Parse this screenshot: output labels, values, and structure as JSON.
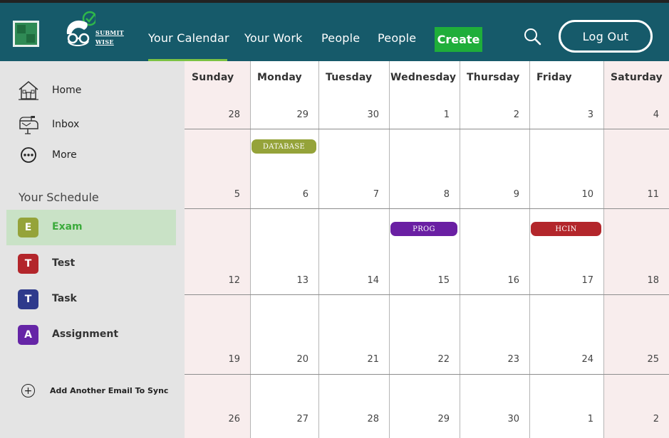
{
  "brand": {
    "name_line1": "SUBMIT",
    "name_line2": "WISE"
  },
  "nav": {
    "items": [
      {
        "label": "Your Calendar"
      },
      {
        "label": "Your Work"
      },
      {
        "label": "People"
      },
      {
        "label": "People"
      }
    ],
    "active_index": 0,
    "create_label": "Create",
    "logout_label": "Log Out"
  },
  "sidebar": {
    "links": [
      {
        "label": "Home",
        "icon": "house-icon"
      },
      {
        "label": "Inbox",
        "icon": "mailbox-icon"
      },
      {
        "label": "More",
        "icon": "more-dots-icon"
      }
    ],
    "schedule_title": "Your Schedule",
    "schedule": [
      {
        "letter": "E",
        "label": "Exam",
        "color": "#95a33a",
        "active": true
      },
      {
        "letter": "T",
        "label": "Test",
        "color": "#b3262b",
        "active": false
      },
      {
        "letter": "T",
        "label": "Task",
        "color": "#2e3a8c",
        "active": false
      },
      {
        "letter": "A",
        "label": "Assignment",
        "color": "#6525a6",
        "active": false
      }
    ],
    "add_email_label": "Add Another Email To Sync"
  },
  "calendar": {
    "days": [
      "Sunday",
      "Monday",
      "Tuesday",
      "Wednesday",
      "Thursday",
      "Friday",
      "Saturday"
    ],
    "weeks": [
      [
        "28",
        "29",
        "30",
        "1",
        "2",
        "3",
        "4"
      ],
      [
        "5",
        "6",
        "7",
        "8",
        "9",
        "10",
        "11"
      ],
      [
        "12",
        "13",
        "14",
        "15",
        "16",
        "17",
        "18"
      ],
      [
        "19",
        "20",
        "21",
        "22",
        "23",
        "24",
        "25"
      ],
      [
        "26",
        "27",
        "28",
        "29",
        "30",
        "1",
        "2"
      ]
    ],
    "events": [
      {
        "label": "DATABASE",
        "week": 1,
        "day": 1,
        "color": "#95a33a"
      },
      {
        "label": "PROG",
        "week": 2,
        "day": 3,
        "color": "#6a1fa3"
      },
      {
        "label": "HCIN",
        "week": 2,
        "day": 5,
        "color": "#b3262b"
      }
    ],
    "weekend_color": "#f8eded"
  }
}
